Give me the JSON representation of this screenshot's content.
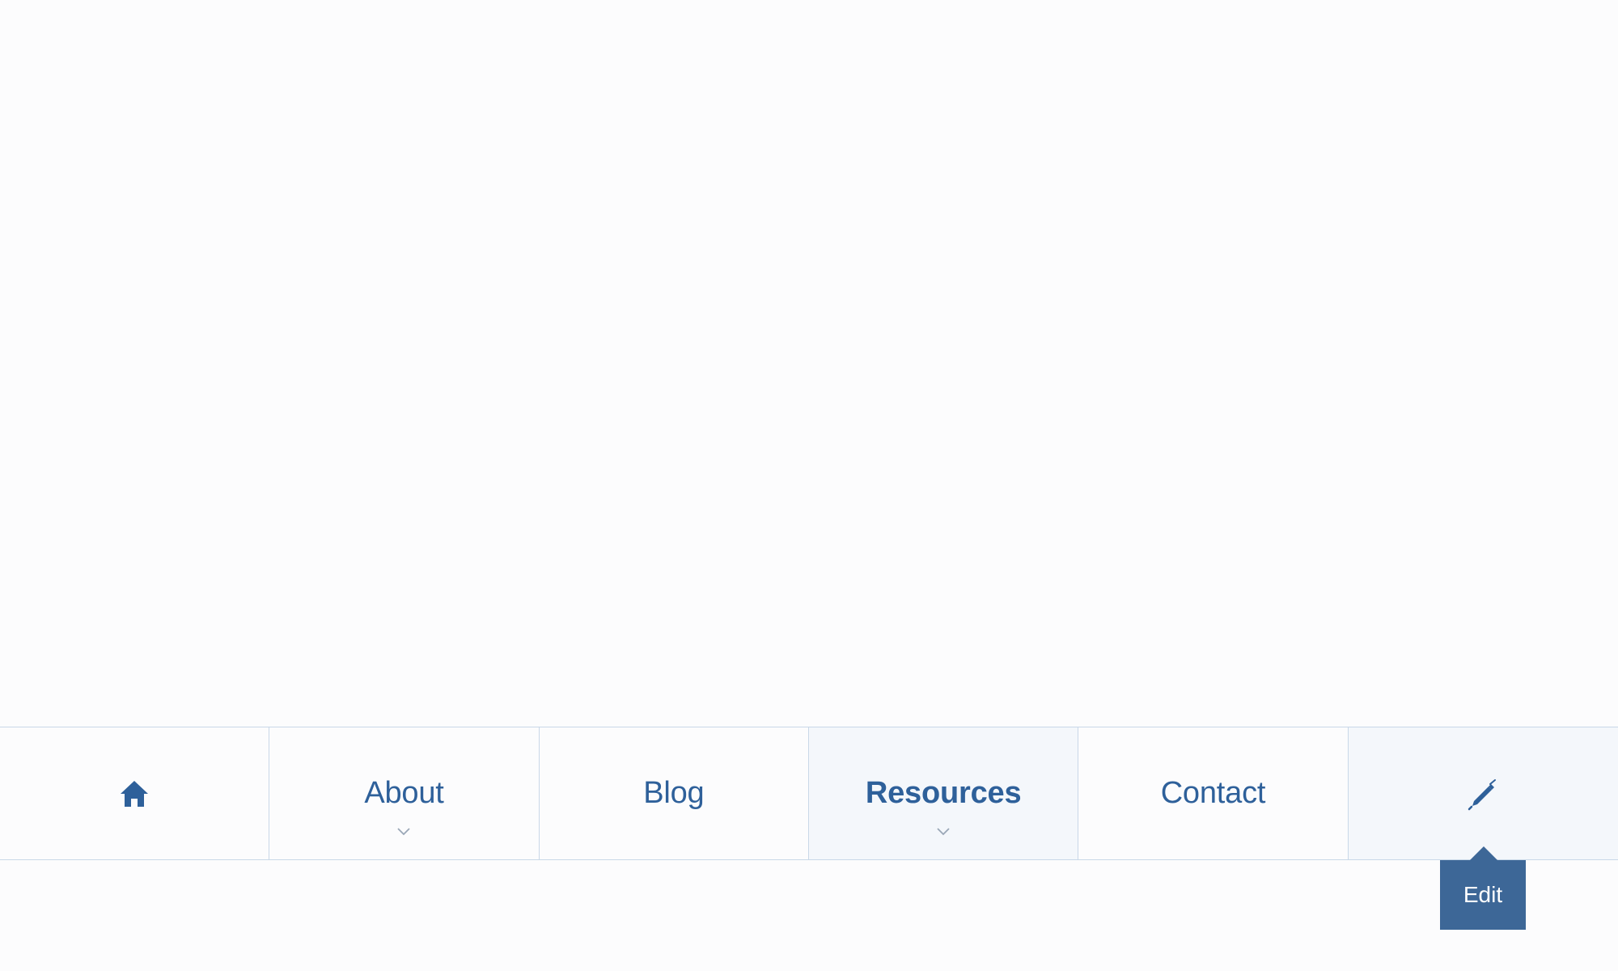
{
  "nav": {
    "home_icon": "home-icon",
    "items": [
      {
        "label": "About",
        "has_dropdown": true
      },
      {
        "label": "Blog",
        "has_dropdown": false
      },
      {
        "label": "Resources",
        "has_dropdown": true,
        "active": true
      },
      {
        "label": "Contact",
        "has_dropdown": false
      }
    ],
    "edit_icon": "pencil-icon"
  },
  "tooltip": {
    "label": "Edit"
  },
  "colors": {
    "page_background": "#fcfcfd",
    "nav_text": "#2e609a",
    "nav_border": "#c9d8e8",
    "active_background": "#f4f7fb",
    "tooltip_background": "#3d6797",
    "tooltip_text": "#ffffff",
    "chevron": "#9aa7b7"
  }
}
